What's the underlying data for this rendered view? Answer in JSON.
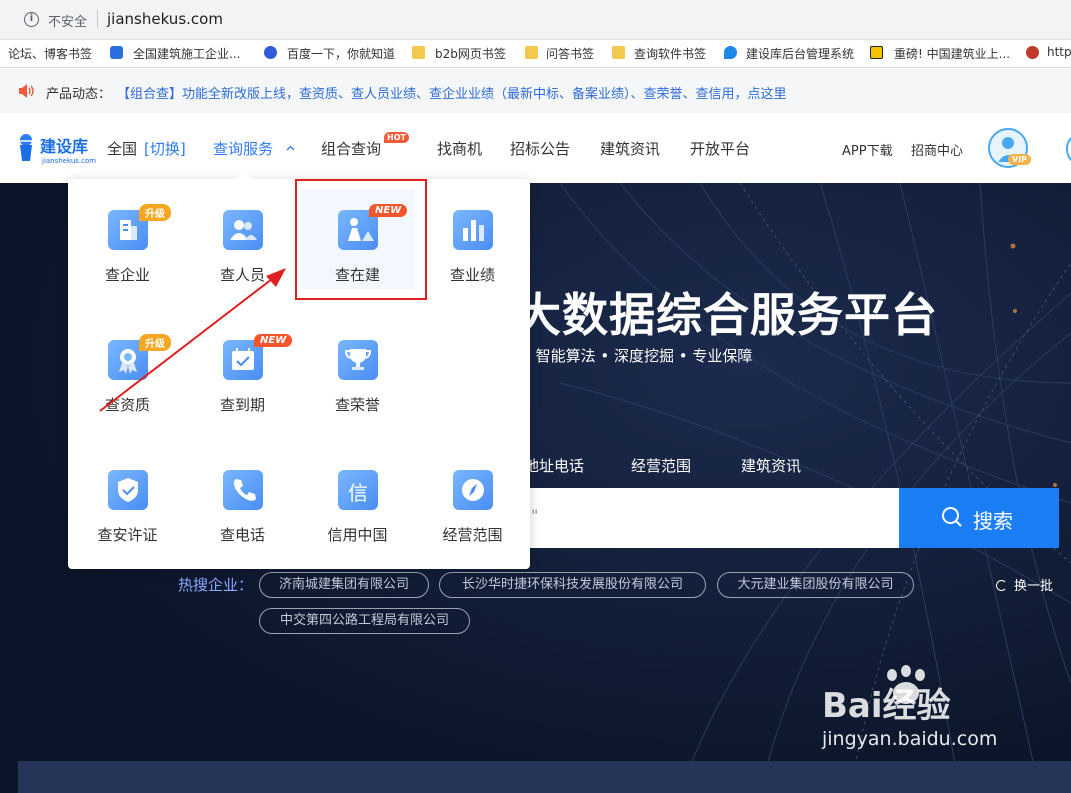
{
  "browser": {
    "security_label": "不安全",
    "url": "jianshekus.com"
  },
  "bookmarks": [
    {
      "label": "论坛、博客书签",
      "icon": "none"
    },
    {
      "label": "全国建筑施工企业...",
      "icon": "shield-icon"
    },
    {
      "label": "百度一下，你就知道",
      "icon": "baidu-paw-icon"
    },
    {
      "label": "b2b网页书签",
      "icon": "folder-icon"
    },
    {
      "label": "问答书签",
      "icon": "folder-icon"
    },
    {
      "label": "查询软件书签",
      "icon": "folder-icon"
    },
    {
      "label": "建设库后台管理系统",
      "icon": "drop-icon"
    },
    {
      "label": "重磅! 中国建筑业上...",
      "icon": "s-logo-icon"
    },
    {
      "label": "http",
      "icon": "globe-icon"
    }
  ],
  "notice": {
    "label": "产品动态：",
    "text": "【组合查】功能全新改版上线，查资质、查人员业绩、查企业业绩（最新中标、备案业绩）、查荣誉、查信用，点这里"
  },
  "header": {
    "logo_cn": "建设库",
    "logo_en": "jianshekus.com",
    "region": "全国",
    "switch": "[切换]",
    "nav": [
      "查询服务",
      "组合查询",
      "找商机",
      "招标公告",
      "建筑资讯",
      "开放平台"
    ],
    "hot_badge": "HOT",
    "app_download": "APP下载",
    "merchant": "招商中心",
    "vip": "VIP"
  },
  "dropdown": {
    "items": [
      {
        "label": "查企业",
        "badge": "升级",
        "badge_type": "up",
        "icon": "building-icon"
      },
      {
        "label": "查人员",
        "badge": "",
        "badge_type": "",
        "icon": "people-icon"
      },
      {
        "label": "查在建",
        "badge": "NEW",
        "badge_type": "new",
        "icon": "construction-worker-icon"
      },
      {
        "label": "查业绩",
        "badge": "",
        "badge_type": "",
        "icon": "bar-chart-icon"
      },
      {
        "label": "查资质",
        "badge": "升级",
        "badge_type": "up",
        "icon": "award-ribbon-icon"
      },
      {
        "label": "查到期",
        "badge": "NEW",
        "badge_type": "new",
        "icon": "calendar-check-icon"
      },
      {
        "label": "查荣誉",
        "badge": "",
        "badge_type": "",
        "icon": "trophy-icon"
      },
      {
        "label": "查安许证",
        "badge": "",
        "badge_type": "",
        "icon": "shield-check-icon"
      },
      {
        "label": "查电话",
        "badge": "",
        "badge_type": "",
        "icon": "phone-icon"
      },
      {
        "label": "信用中国",
        "badge": "",
        "badge_type": "",
        "icon": "xin-character-icon",
        "glyph": "信"
      },
      {
        "label": "经营范围",
        "badge": "",
        "badge_type": "",
        "icon": "compass-icon"
      }
    ]
  },
  "hero": {
    "title": "大数据综合服务平台",
    "subtitle": "• 智能算法 • 深度挖掘 • 专业保障",
    "tabs": [
      "地址电话",
      "经营范围",
      "建筑资讯"
    ],
    "search_placeholder": "\"",
    "search_button": "搜索",
    "hot_label": "热搜企业：",
    "hot_companies": [
      "济南城建集团有限公司",
      "长沙华时捷环保科技发展股份有限公司",
      "大元建业集团股份有限公司",
      "中交第四公路工程局有限公司"
    ],
    "refresh": "换一批",
    "watermark": "Bai经验",
    "watermark_url": "jingyan.baidu.com"
  },
  "colors": {
    "accent": "#1b7ef7",
    "hero_bg": "#0f1a33",
    "highlight_box": "#e02020",
    "badge_new": "#f4552c",
    "badge_up": "#f5a623"
  }
}
